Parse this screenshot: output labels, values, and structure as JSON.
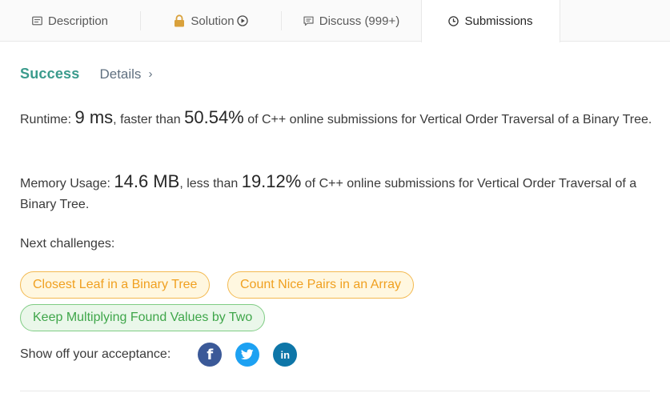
{
  "tabs": [
    {
      "label": "Description",
      "icon": "description-icon"
    },
    {
      "label": "Solution",
      "icon": "lock-icon",
      "suffix_icon": "play-circle-icon"
    },
    {
      "label": "Discuss (999+)",
      "icon": "comment-icon"
    },
    {
      "label": "Submissions",
      "icon": "clock-icon"
    }
  ],
  "result": {
    "status": "Success",
    "details_label": "Details",
    "details_chevron": "›"
  },
  "runtime": {
    "label": "Runtime:",
    "value": "9 ms",
    "comparison": ", faster than",
    "percent": "50.54%",
    "suffix": "of C++ online submissions for Vertical Order Traversal of a Binary Tree."
  },
  "memory": {
    "label": "Memory Usage:",
    "value": "14.6 MB",
    "comparison": ", less than",
    "percent": "19.12%",
    "suffix": "of C++ online submissions for Vertical Order Traversal of a Binary Tree."
  },
  "next_challenges": {
    "label": "Next challenges:",
    "items": [
      {
        "label": "Closest Leaf in a Binary Tree",
        "difficulty_color": "#f0a020"
      },
      {
        "label": "Count Nice Pairs in an Array",
        "difficulty_color": "#f0a020"
      },
      {
        "label": "Keep Multiplying Found Values by Two",
        "difficulty_color": "#3fa64a"
      }
    ]
  },
  "share": {
    "label": "Show off your acceptance:",
    "networks": [
      {
        "name": "facebook",
        "glyph": "f",
        "color": "#3b5998"
      },
      {
        "name": "twitter",
        "glyph": "",
        "color": "#1da1f2"
      },
      {
        "name": "linkedin",
        "glyph": "in",
        "color": "#0e76a8"
      }
    ]
  },
  "colors": {
    "success": "#3a9b8c",
    "accent_text": "#607080"
  }
}
